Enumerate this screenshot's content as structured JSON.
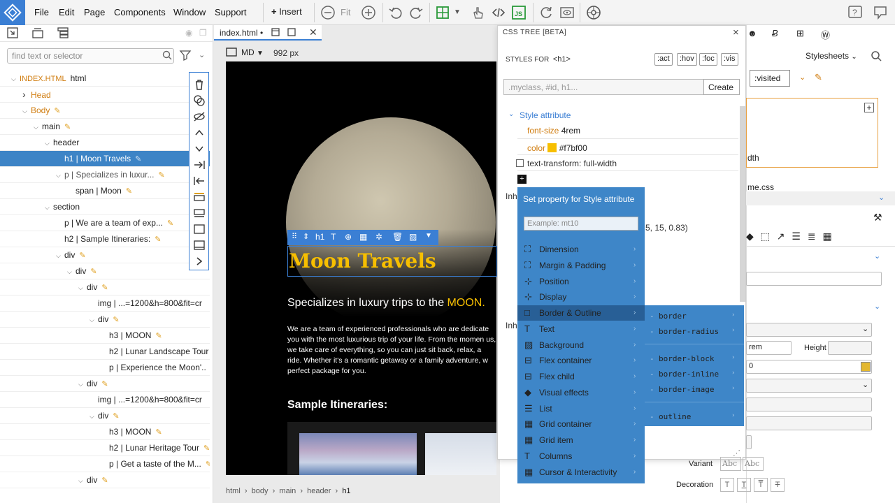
{
  "menu": [
    "File",
    "Edit",
    "Page",
    "Components",
    "Window",
    "Support"
  ],
  "toolbar": {
    "insert_label": "Insert",
    "fit_label": "Fit"
  },
  "left_panel": {
    "search_placeholder": "find text or selector",
    "tree": [
      {
        "text": "INDEX.HTML",
        "extra": "html",
        "indent": 0,
        "caret": "down",
        "type": "root"
      },
      {
        "text": "Head",
        "indent": 1,
        "caret": "right",
        "type": "orange"
      },
      {
        "text": "Body",
        "indent": 1,
        "caret": "down",
        "type": "orange",
        "pencil": true
      },
      {
        "text": "main",
        "indent": 2,
        "caret": "down",
        "pencil": true
      },
      {
        "text": "header",
        "indent": 3,
        "caret": "down"
      },
      {
        "text": "h1 | Moon Travels",
        "indent": 4,
        "caret": "",
        "selected": true,
        "pencil": true
      },
      {
        "text": "p | Specializes in luxur...",
        "indent": 4,
        "caret": "down",
        "pencil": true,
        "gray": true
      },
      {
        "text": "span | Moon",
        "indent": 5,
        "caret": "",
        "pencil": true
      },
      {
        "text": "section",
        "indent": 3,
        "caret": "down"
      },
      {
        "text": "p | We are a team of exp...",
        "indent": 4,
        "caret": "",
        "pencil": true
      },
      {
        "text": "h2 | Sample Itineraries:",
        "indent": 4,
        "caret": "",
        "pencil": true
      },
      {
        "text": "div",
        "indent": 4,
        "caret": "down",
        "pencil": true
      },
      {
        "text": "div",
        "indent": 5,
        "caret": "down",
        "pencil": true
      },
      {
        "text": "div",
        "indent": 6,
        "caret": "down",
        "pencil": true
      },
      {
        "text": "img | ...=1200&h=800&fit=cr",
        "indent": 7,
        "caret": ""
      },
      {
        "text": "div",
        "indent": 7,
        "caret": "down",
        "pencil": true
      },
      {
        "text": "h3 | MOON",
        "indent": 8,
        "caret": "",
        "pencil": true
      },
      {
        "text": "h2 | Lunar Landscape Tour",
        "indent": 8,
        "caret": ""
      },
      {
        "text": "p | Experience the Moon'..",
        "indent": 8,
        "caret": ""
      },
      {
        "text": "div",
        "indent": 6,
        "caret": "down",
        "pencil": true
      },
      {
        "text": "img | ...=1200&h=800&fit=cr",
        "indent": 7,
        "caret": ""
      },
      {
        "text": "div",
        "indent": 7,
        "caret": "down",
        "pencil": true
      },
      {
        "text": "h3 | MOON",
        "indent": 8,
        "caret": "",
        "pencil": true
      },
      {
        "text": "h2 | Lunar Heritage Tour",
        "indent": 8,
        "caret": "",
        "pencil": true
      },
      {
        "text": "p | Get a taste of the M...",
        "indent": 8,
        "caret": "",
        "pencil": true
      },
      {
        "text": "div",
        "indent": 6,
        "caret": "down",
        "pencil": true
      }
    ]
  },
  "editor": {
    "tab": "index.html •",
    "breakpoint": "MD",
    "width": "992 px",
    "h1": "Moon Travels",
    "h1_tag": "h1",
    "p_short": "Specializes in luxury trips to the ",
    "p_short_span": "MOON.",
    "p_body": "We are a team of experienced professionals who are dedicate you with the most luxurious trip of your life. From the momen us, we take care of everything, so you can just sit back, relax, a ride. Whether it's a romantic getaway or a family adventure, w perfect package for you.",
    "h2": "Sample Itineraries:",
    "breadcrumb": [
      "html",
      "body",
      "main",
      "header",
      "h1"
    ]
  },
  "css_tree": {
    "title": "CSS TREE [BETA]",
    "styles_for_label": "STYLES FOR",
    "styles_for_tag": "<h1>",
    "pseudo": [
      ":act",
      ":hov",
      ":foc",
      ":vis"
    ],
    "class_placeholder": ".myclass, #id, h1...",
    "create_label": "Create",
    "style_attr_label": "Style attribute",
    "props": [
      {
        "name": "font-size",
        "value": "4rem"
      },
      {
        "name": "color",
        "value": "#f7bf00",
        "swatch": "#f7bf00"
      }
    ],
    "disabled_prop": "text-transform: full-width",
    "inh1": "Inh",
    "inh2": "Inh",
    "partial_value": "5, 15, 0.83)"
  },
  "dropdown": {
    "header": "Set property for Style attribute",
    "input_placeholder": "Example: mt10",
    "items": [
      "Dimension",
      "Margin & Padding",
      "Position",
      "Display",
      "Border & Outline",
      "Text",
      "Background",
      "Flex container",
      "Flex child",
      "Visual effects",
      "List",
      "Grid container",
      "Grid item",
      "Columns",
      "Cursor & Interactivity"
    ],
    "highlighted": "Border & Outline",
    "submenu": [
      "border",
      "border-radius",
      "border-block",
      "border-inline",
      "border-image",
      "outline"
    ]
  },
  "right_panel": {
    "stylesheets_label": "Stylesheets",
    "visited_label": ":visited",
    "width_partial": "dth",
    "css_file_partial": "me.css",
    "rem_partial": "rem",
    "height_label": "Height",
    "zero_partial": "0",
    "variant_label": "Variant",
    "decoration_label": "Decoration",
    "abc1": "Abc",
    "abc2": "Abc"
  }
}
